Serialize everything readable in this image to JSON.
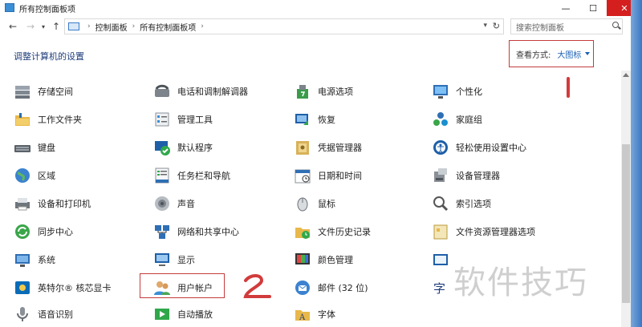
{
  "window": {
    "title": "所有控制面板项",
    "controls": [
      "minimize",
      "maximize",
      "close"
    ]
  },
  "addressbar": {
    "breadcrumbs": [
      "控制面板",
      "所有控制面板项"
    ],
    "search_placeholder": "搜索控制面板"
  },
  "page": {
    "heading": "调整计算机的设置",
    "view_label": "查看方式:",
    "view_value": "大图标"
  },
  "columns": [
    {
      "items": [
        {
          "label": "存储空间",
          "icon": "storage-icon"
        },
        {
          "label": "工作文件夹",
          "icon": "folder-icon"
        },
        {
          "label": "键盘",
          "icon": "keyboard-icon"
        },
        {
          "label": "区域",
          "icon": "globe-icon"
        },
        {
          "label": "设备和打印机",
          "icon": "printer-icon"
        },
        {
          "label": "同步中心",
          "icon": "sync-icon"
        },
        {
          "label": "系统",
          "icon": "computer-icon"
        },
        {
          "label": "英特尔® 核芯显卡",
          "icon": "intel-graphics-icon"
        },
        {
          "label": "语音识别",
          "icon": "microphone-icon"
        }
      ]
    },
    {
      "items": [
        {
          "label": "电话和调制解调器",
          "icon": "phone-icon"
        },
        {
          "label": "管理工具",
          "icon": "tools-icon"
        },
        {
          "label": "默认程序",
          "icon": "default-programs-icon"
        },
        {
          "label": "任务栏和导航",
          "icon": "taskbar-icon"
        },
        {
          "label": "声音",
          "icon": "speaker-icon"
        },
        {
          "label": "网络和共享中心",
          "icon": "network-icon"
        },
        {
          "label": "显示",
          "icon": "monitor-icon"
        },
        {
          "label": "用户帐户",
          "icon": "users-icon"
        },
        {
          "label": "自动播放",
          "icon": "autoplay-icon"
        }
      ]
    },
    {
      "items": [
        {
          "label": "电源选项",
          "icon": "power-icon"
        },
        {
          "label": "恢复",
          "icon": "recovery-icon"
        },
        {
          "label": "凭据管理器",
          "icon": "credential-icon"
        },
        {
          "label": "日期和时间",
          "icon": "calendar-icon"
        },
        {
          "label": "鼠标",
          "icon": "mouse-icon"
        },
        {
          "label": "文件历史记录",
          "icon": "file-history-icon"
        },
        {
          "label": "颜色管理",
          "icon": "color-icon"
        },
        {
          "label": "邮件 (32 位)",
          "icon": "mail-icon"
        },
        {
          "label": "字体",
          "icon": "font-icon"
        }
      ]
    },
    {
      "items": [
        {
          "label": "个性化",
          "icon": "personalize-icon"
        },
        {
          "label": "家庭组",
          "icon": "homegroup-icon"
        },
        {
          "label": "轻松使用设置中心",
          "icon": "ease-of-access-icon"
        },
        {
          "label": "设备管理器",
          "icon": "device-manager-icon"
        },
        {
          "label": "索引选项",
          "icon": "index-icon"
        },
        {
          "label": "文件资源管理器选项",
          "icon": "explorer-options-icon"
        },
        {
          "label": "",
          "icon": "window-icon"
        },
        {
          "label": "",
          "icon": "language-icon"
        }
      ]
    }
  ],
  "annotations": {
    "mark_1": "1",
    "mark_2": "2"
  },
  "watermark": "软件技巧",
  "colors": {
    "accent": "#1a5fb4",
    "highlight_border": "#c43b3b",
    "close_button": "#d51e1e"
  }
}
